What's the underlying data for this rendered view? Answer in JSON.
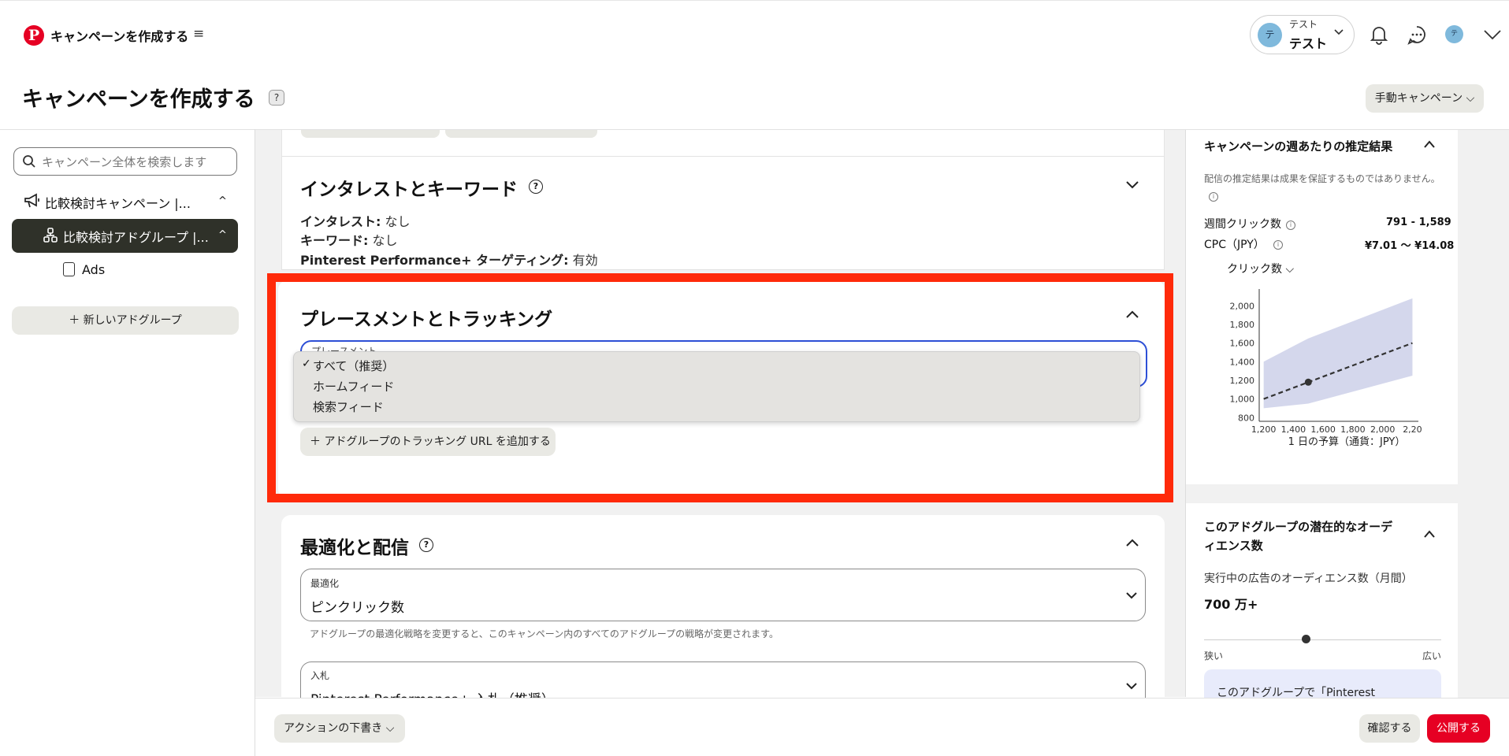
{
  "app": {
    "title": "キャンペーンを作成する",
    "hamburger": "≡"
  },
  "account": {
    "avatar": "テ",
    "line1": "テスト",
    "line2": "テスト",
    "mini_avatar": "テ"
  },
  "page": {
    "title": "キャンペーンを作成する",
    "help": "?",
    "mode_button": "手動キャンペーン"
  },
  "sidebar": {
    "search_placeholder": "キャンペーン全体を検索します",
    "campaign_label": "比較検討キャンペーン |...",
    "adgroup_label": "比較検討アドグループ |...",
    "ads_label": "Ads",
    "new_adgroup": "＋ 新しいアドグループ"
  },
  "sections": {
    "interest": {
      "title": "インタレストとキーワード",
      "help": "?",
      "interest_key": "インタレスト:",
      "interest_val": " なし",
      "keyword_key": "キーワード:",
      "keyword_val": " なし",
      "targeting_key": "Pinterest Performance+ ターゲティング:",
      "targeting_val": " 有効"
    },
    "placement": {
      "title": "プレースメントとトラッキング",
      "field_hint": "プレースメント",
      "check": "✓",
      "options": [
        "すべて（推奨）",
        "ホームフィード",
        "検索フィード"
      ],
      "tracking_button": "＋ アドグループのトラッキング URL を追加する"
    },
    "optimization": {
      "title": "最適化と配信",
      "help": "?",
      "opt_label": "最適化",
      "opt_value": "ピンクリック数",
      "opt_help": "アドグループの最適化戦略を変更すると、このキャンペーン内のすべてのアドグループの戦略が変更されます。",
      "bid_label": "入札",
      "bid_value": "Pinterest Performance+ 入札（推奨）"
    }
  },
  "bottom": {
    "draft": "アクションの下書き",
    "confirm": "確認する",
    "publish": "公開する"
  },
  "right_panel": {
    "est_title": "キャンペーンの週あたりの推定結果",
    "est_note": "配信の推定結果は成果を保証するものではありません。",
    "info": "i",
    "weekly_clicks_label": "週間クリック数",
    "weekly_clicks_value": "791 - 1,589",
    "cpc_label": "CPC（JPY）",
    "cpc_value": "¥7.01 ～ ¥14.08",
    "metric_select": "クリック数",
    "audience_title": "このアドグループの潜在的なオーディエンス数",
    "audience_label": "実行中の広告のオーディエンス数（月間）",
    "audience_value": "700 万+",
    "slider_left": "狭い",
    "slider_right": "広い",
    "slider_level": 0.43,
    "note_text": "このアドグループで「Pinterest"
  },
  "chart_data": {
    "type": "line",
    "xlabel": "1 日の予算（通貨：JPY）",
    "ylabel": "",
    "x_ticks": [
      "1,200",
      "1,400",
      "1,600",
      "1,800",
      "2,000",
      "2,20"
    ],
    "y_ticks": [
      "2,000",
      "1,800",
      "1,600",
      "1,400",
      "1,200",
      "1,000",
      "800"
    ],
    "xlim": [
      1170,
      2240
    ],
    "ylim": [
      760,
      2180
    ],
    "series": [
      {
        "type": "line",
        "dashed": true,
        "x": [
          1200,
          2200
        ],
        "y": [
          1000,
          1600
        ]
      },
      {
        "type": "band",
        "x": [
          1200,
          1500,
          2200
        ],
        "low": [
          900,
          950,
          1250
        ],
        "high": [
          1400,
          1650,
          2080
        ]
      }
    ],
    "marker": {
      "x": 1500,
      "y": 1180
    },
    "colors": {
      "band": "#cfd3ea",
      "line": "#333333"
    }
  }
}
